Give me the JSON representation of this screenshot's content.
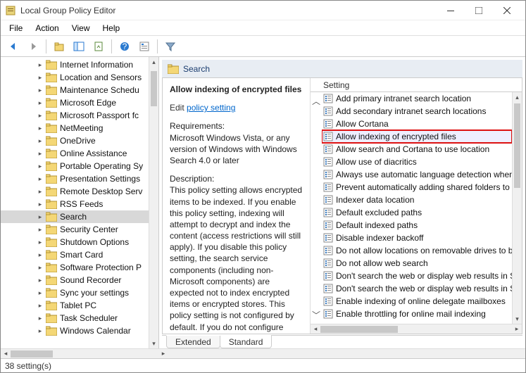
{
  "window": {
    "title": "Local Group Policy Editor"
  },
  "menu": {
    "file": "File",
    "action": "Action",
    "view": "View",
    "help": "Help"
  },
  "sidebar": {
    "items": [
      {
        "label": "Internet Information"
      },
      {
        "label": "Location and Sensors"
      },
      {
        "label": "Maintenance Schedu"
      },
      {
        "label": "Microsoft Edge"
      },
      {
        "label": "Microsoft Passport fc"
      },
      {
        "label": "NetMeeting"
      },
      {
        "label": "OneDrive"
      },
      {
        "label": "Online Assistance"
      },
      {
        "label": "Portable Operating Sy"
      },
      {
        "label": "Presentation Settings"
      },
      {
        "label": "Remote Desktop Serv"
      },
      {
        "label": "RSS Feeds"
      },
      {
        "label": "Search",
        "selected": true
      },
      {
        "label": "Security Center"
      },
      {
        "label": "Shutdown Options"
      },
      {
        "label": "Smart Card"
      },
      {
        "label": "Software Protection P"
      },
      {
        "label": "Sound Recorder"
      },
      {
        "label": "Sync your settings"
      },
      {
        "label": "Tablet PC"
      },
      {
        "label": "Task Scheduler"
      },
      {
        "label": "Windows Calendar"
      }
    ]
  },
  "detail": {
    "header": "Search",
    "item_title": "Allow indexing of encrypted files",
    "edit_prefix": "Edit ",
    "edit_link": "policy setting ",
    "req_label": "Requirements:",
    "req_text": "Microsoft Windows Vista, or any version of Windows with Windows Search 4.0 or later",
    "desc_label": "Description:",
    "desc_text": "This policy setting allows encrypted items to be indexed. If you enable this policy setting, indexing  will attempt to decrypt and index the content (access restrictions will still apply).  If you disable this policy setting, the search service components (including non-Microsoft components) are expected not to index encrypted items or encrypted stores. This policy setting is not configured by default. If you do not configure"
  },
  "list": {
    "column": "Setting",
    "items": [
      {
        "label": "Add primary intranet search location"
      },
      {
        "label": "Add secondary intranet search locations"
      },
      {
        "label": "Allow Cortana"
      },
      {
        "label": "Allow indexing of encrypted files",
        "highlighted": true
      },
      {
        "label": "Allow search and Cortana to use location"
      },
      {
        "label": "Allow use of diacritics"
      },
      {
        "label": "Always use automatic language detection when in"
      },
      {
        "label": "Prevent automatically adding shared folders to th"
      },
      {
        "label": "Indexer data location"
      },
      {
        "label": "Default excluded paths"
      },
      {
        "label": "Default indexed paths"
      },
      {
        "label": "Disable indexer backoff"
      },
      {
        "label": "Do not allow locations on removable drives to be"
      },
      {
        "label": "Do not allow web search"
      },
      {
        "label": "Don't search the web or display web results in Sea"
      },
      {
        "label": "Don't search the web or display web results in Sea"
      },
      {
        "label": "Enable indexing of online delegate mailboxes"
      },
      {
        "label": "Enable throttling for online mail indexing"
      }
    ]
  },
  "tabs": {
    "extended": "Extended",
    "standard": "Standard"
  },
  "status": {
    "text": "38 setting(s)"
  }
}
